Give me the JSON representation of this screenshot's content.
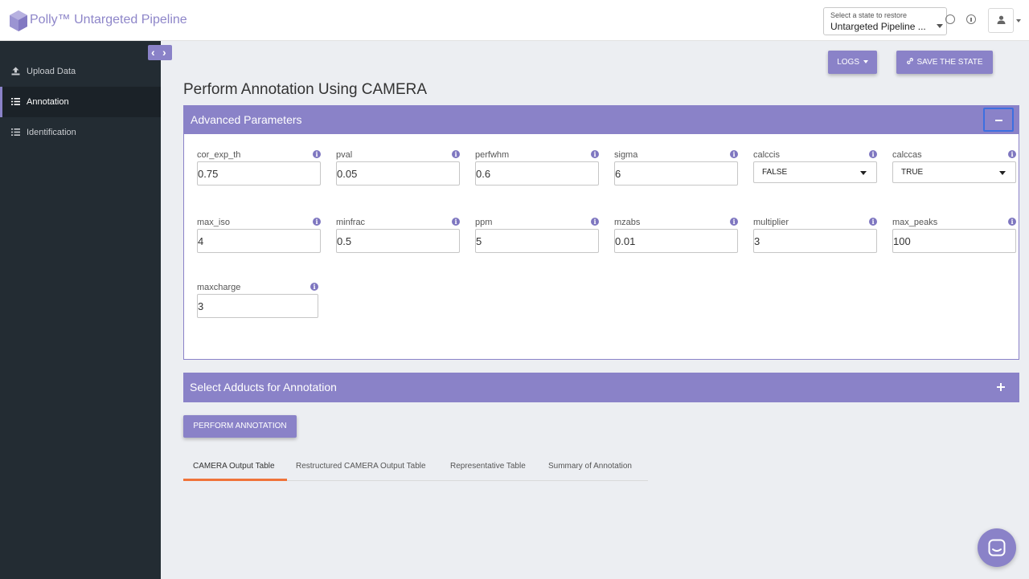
{
  "header": {
    "app_title": "Polly™ Untargeted Pipeline",
    "state_select_label": "Select a state to restore",
    "state_select_value": "Untargeted Pipeline ...",
    "icons": [
      "history-icon",
      "info-icon",
      "user-icon"
    ]
  },
  "sidebar": {
    "items": [
      {
        "label": "Upload Data",
        "icon": "upload-icon",
        "active": false
      },
      {
        "label": "Annotation",
        "icon": "list-icon",
        "active": true
      },
      {
        "label": "Identification",
        "icon": "list-icon",
        "active": false
      }
    ]
  },
  "toolbar": {
    "logs_label": "LOGS",
    "save_state_label": "SAVE THE STATE"
  },
  "page": {
    "title": "Perform Annotation Using CAMERA"
  },
  "advanced": {
    "title": "Advanced Parameters",
    "fields": [
      {
        "label": "cor_exp_th",
        "value": "0.75"
      },
      {
        "label": "pval",
        "value": "0.05"
      },
      {
        "label": "perfwhm",
        "value": "0.6"
      },
      {
        "label": "sigma",
        "value": "6"
      },
      {
        "label": "calccis",
        "value": "FALSE"
      },
      {
        "label": "calccas",
        "value": "TRUE"
      },
      {
        "label": "max_iso",
        "value": "4"
      },
      {
        "label": "minfrac",
        "value": "0.5"
      },
      {
        "label": "ppm",
        "value": "5"
      },
      {
        "label": "mzabs",
        "value": "0.01"
      },
      {
        "label": "multiplier",
        "value": "3"
      },
      {
        "label": "max_peaks",
        "value": "100"
      },
      {
        "label": "maxcharge",
        "value": "3"
      }
    ]
  },
  "adducts": {
    "title": "Select Adducts for Annotation"
  },
  "actions": {
    "perform_label": "PERFORM ANNOTATION"
  },
  "tabs": [
    {
      "label": "CAMERA Output Table",
      "active": true
    },
    {
      "label": "Restructured CAMERA Output Table",
      "active": false
    },
    {
      "label": "Representative Table",
      "active": false
    },
    {
      "label": "Summary of Annotation",
      "active": false
    }
  ],
  "colors": {
    "accent": "#8a82c8",
    "sidebar_bg": "#232c33",
    "tab_underline": "#f0733a",
    "focus_outline": "#3d6fe0"
  }
}
